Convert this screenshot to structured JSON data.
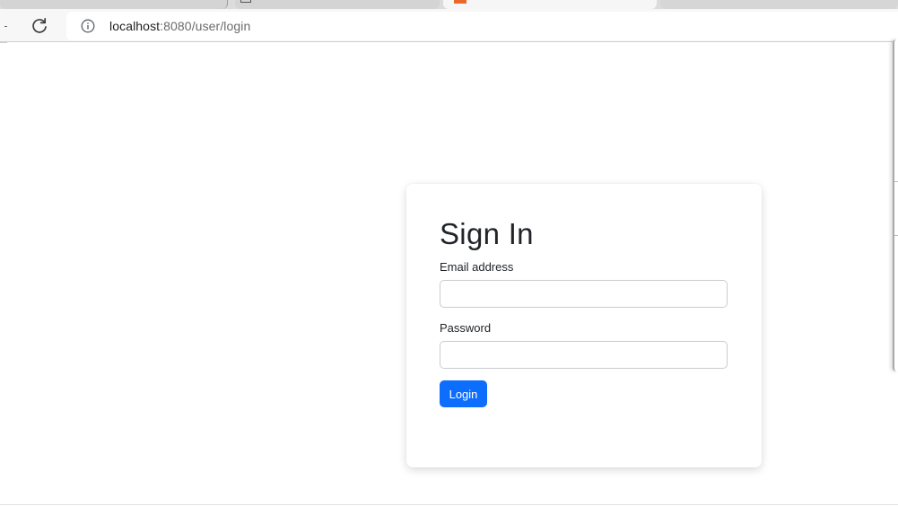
{
  "browser": {
    "address_bar": {
      "host": "localhost",
      "path": ":8080/user/login"
    },
    "icons": {
      "reload": "reload-icon",
      "site_info": "info-icon"
    },
    "colors": {
      "active_tab_favicon": "#e8692a"
    }
  },
  "login_form": {
    "title": "Sign In",
    "email_label": "Email address",
    "email_value": "",
    "password_label": "Password",
    "password_value": "",
    "submit_label": "Login",
    "colors": {
      "primary_button": "#0d6efd"
    }
  }
}
